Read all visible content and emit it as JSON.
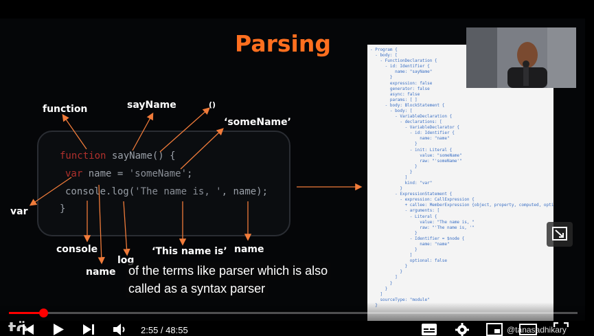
{
  "slide": {
    "title": "Parsing",
    "code": {
      "line1": {
        "kw": "function",
        "name": " sayName",
        "rest": "() {"
      },
      "line2": {
        "kw": "var",
        "rest": " name = ",
        "str": "'someName'",
        "end": ";"
      },
      "line3": {
        "obj": "console",
        "dot": ".log(",
        "str": "'The name is, '",
        "end": ", name);"
      },
      "line4": "}"
    },
    "labels": {
      "function": "function",
      "sayName": "sayName",
      "parens": "()",
      "someName": "‘someName’",
      "var": "var",
      "console": "console",
      "log": "log",
      "name_lower": "name",
      "this_name_is": "‘This name is’",
      "name_right": "name"
    },
    "ast_lines": [
      "- Program {",
      "  - body: [",
      "    - FunctionDeclaration {",
      "      - id: Identifier {",
      "          name: \"sayName\"",
      "        }",
      "        expression: false",
      "        generator: false",
      "        async: false",
      "        params: [ ]",
      "      - body: BlockStatement {",
      "        - body: [",
      "          - VariableDeclaration {",
      "            - declarations: [",
      "              - VariableDeclarator {",
      "                - id: Identifier {",
      "                    name: \"name\"",
      "                  }",
      "                - init: Literal {",
      "                    value: \"someName\"",
      "                    raw: \"'someName'\"",
      "                  }",
      "                }",
      "              ]",
      "              kind: \"var\"",
      "            }",
      "          - ExpressionStatement {",
      "            - expression: CallExpression {",
      "              + callee: MemberExpression {object, property, computed, optional}",
      "              - arguments: [",
      "                - Literal {",
      "                    value: \"The name is, \"",
      "                    raw: \"'The name is, '\"",
      "                  }",
      "                - Identifier = $node {",
      "                    name: \"name\"",
      "                  }",
      "                ]",
      "                optional: false",
      "              }",
      "            }",
      "          ]",
      "        }",
      "      }",
      "    ]",
      "    sourceType: \"module\"",
      "  }"
    ]
  },
  "subtitles": {
    "line1": "of the terms like parser which is also",
    "line2": "called as a syntax parser"
  },
  "player": {
    "time": "2:55 / 48:55",
    "progress_fraction": 0.06,
    "channel": "@tanasadhikary",
    "icons": [
      "previous-icon",
      "play-icon",
      "next-icon",
      "volume-icon",
      "subtitles-icon",
      "settings-icon",
      "miniplayer-icon",
      "theater-icon",
      "fullscreen-icon",
      "pip-icon"
    ]
  },
  "colors": {
    "accent": "#ff6f1f",
    "progress": "#ff0000",
    "keyword": "#b0302c",
    "string": "#8a8f97",
    "plain": "#9aa0a8",
    "ast": "#3a6fc4"
  }
}
